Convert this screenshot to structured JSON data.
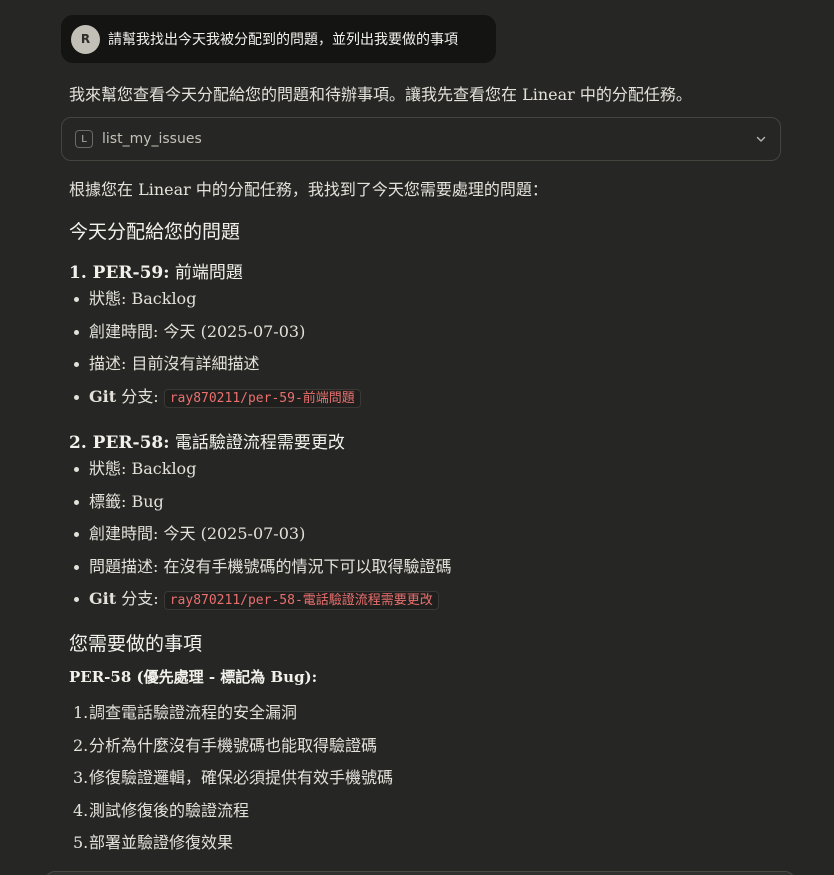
{
  "user_message": {
    "avatar_initial": "R",
    "text": "請幫我找出今天我被分配到的問題，並列出我要做的事項"
  },
  "assistant": {
    "intro": "我來幫您查看今天分配給您的問題和待辦事項。讓我先查看您在 Linear 中的分配任務。",
    "tool_call": {
      "badge": "L",
      "name": "list_my_issues"
    },
    "result_intro": "根據您在 Linear 中的分配任務，我找到了今天您需要處理的問題：",
    "section1_title": "今天分配給您的問題",
    "issues": [
      {
        "heading_id": "1. PER-59:",
        "heading_text": " 前端問題",
        "fields": [
          {
            "label": "狀態: ",
            "value": "Backlog"
          },
          {
            "label": "創建時間: ",
            "value": "今天 (2025-07-03)"
          },
          {
            "label": "描述: ",
            "value": "目前沒有詳細描述"
          }
        ],
        "git_label_bold": "Git",
        "git_label_rest": " 分支: ",
        "git_branch": "ray870211/per-59-前端問題"
      },
      {
        "heading_id": "2. PER-58:",
        "heading_text": " 電話驗證流程需要更改",
        "fields": [
          {
            "label": "狀態: ",
            "value": "Backlog"
          },
          {
            "label": "標籤: ",
            "value": "Bug"
          },
          {
            "label": "創建時間: ",
            "value": "今天 (2025-07-03)"
          },
          {
            "label": "問題描述: ",
            "value": "在沒有手機號碼的情況下可以取得驗證碼"
          }
        ],
        "git_label_bold": "Git",
        "git_label_rest": " 分支: ",
        "git_branch": "ray870211/per-58-電話驗證流程需要更改"
      }
    ],
    "section2_title": "您需要做的事項",
    "todo_heading": "PER-58 (優先處理 - 標記為 Bug):",
    "todo_steps": [
      {
        "num": "1.",
        "text": "調查電話驗證流程的安全漏洞"
      },
      {
        "num": "2.",
        "text": "分析為什麼沒有手機號碼也能取得驗證碼"
      },
      {
        "num": "3.",
        "text": "修復驗證邏輯，確保必須提供有效手機號碼"
      },
      {
        "num": "4.",
        "text": "測試修復後的驗證流程"
      },
      {
        "num": "5.",
        "text": "部署並驗證修復效果"
      }
    ]
  }
}
